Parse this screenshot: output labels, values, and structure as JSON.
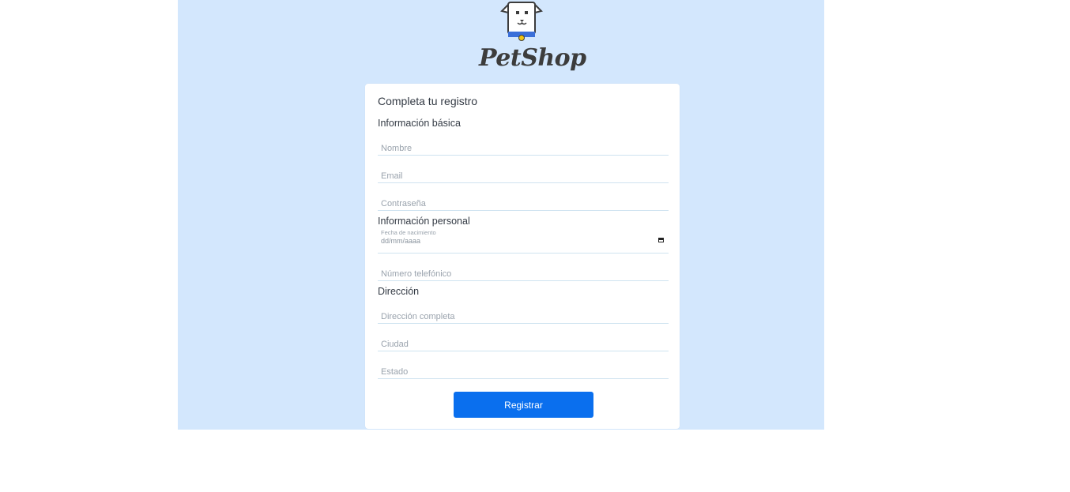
{
  "brand": {
    "name": "PetShop",
    "colors": {
      "background": "#d3e7fd",
      "card": "#ffffff",
      "primary": "#0a6fee"
    }
  },
  "form": {
    "title": "Completa tu registro",
    "sections": {
      "basic": "Información básica",
      "personal": "Información personal",
      "address": "Dirección"
    },
    "fields": {
      "name_placeholder": "Nombre",
      "email_placeholder": "Email",
      "password_placeholder": "Contraseña",
      "birthdate_label": "Fecha de nacimiento",
      "birthdate_value": "dd/mm/aaaa",
      "phone_placeholder": "Número telefónico",
      "address_placeholder": "Dirección completa",
      "city_placeholder": "Ciudad",
      "state_placeholder": "Estado"
    },
    "submit_label": "Registrar"
  }
}
